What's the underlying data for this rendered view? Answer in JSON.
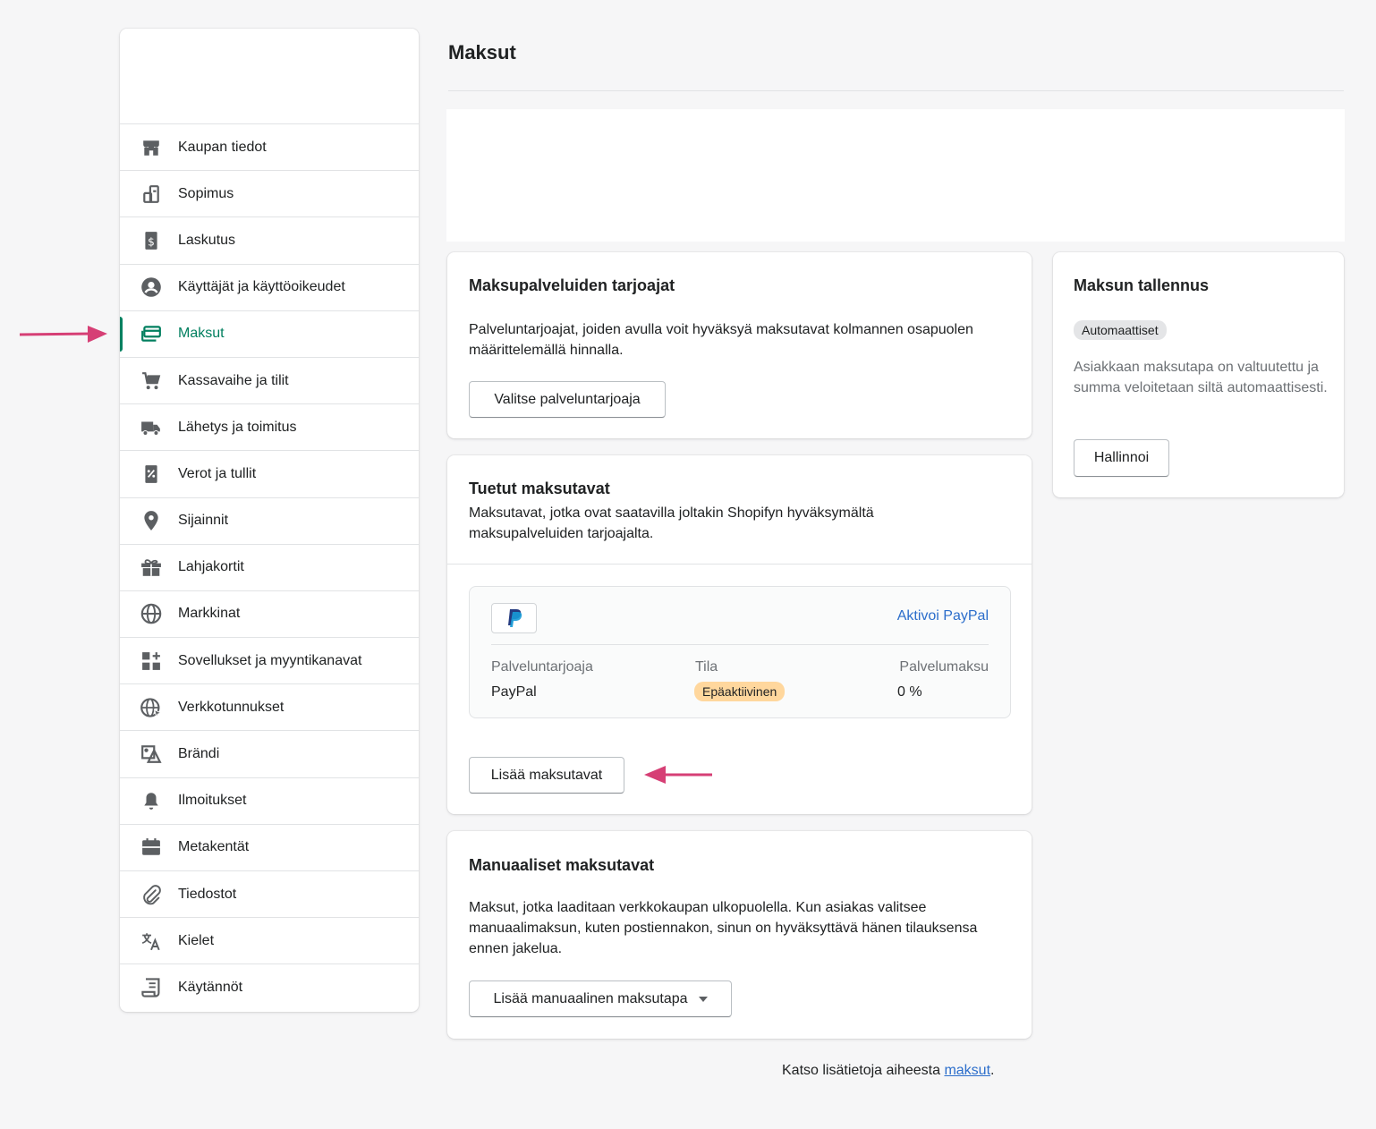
{
  "page": {
    "title": "Maksut"
  },
  "sidebar": {
    "items": [
      {
        "label": "Kaupan tiedot",
        "icon": "store-icon"
      },
      {
        "label": "Sopimus",
        "icon": "plan-icon"
      },
      {
        "label": "Laskutus",
        "icon": "billing-icon"
      },
      {
        "label": "Käyttäjät ja käyttöoikeudet",
        "icon": "user-icon"
      },
      {
        "label": "Maksut",
        "icon": "payments-icon",
        "active": true
      },
      {
        "label": "Kassavaihe ja tilit",
        "icon": "cart-icon"
      },
      {
        "label": "Lähetys ja toimitus",
        "icon": "truck-icon"
      },
      {
        "label": "Verot ja tullit",
        "icon": "tax-icon"
      },
      {
        "label": "Sijainnit",
        "icon": "location-icon"
      },
      {
        "label": "Lahjakortit",
        "icon": "gift-icon"
      },
      {
        "label": "Markkinat",
        "icon": "globe-icon"
      },
      {
        "label": "Sovellukset ja myyntikanavat",
        "icon": "apps-icon"
      },
      {
        "label": "Verkkotunnukset",
        "icon": "domain-icon"
      },
      {
        "label": "Brändi",
        "icon": "brand-icon"
      },
      {
        "label": "Ilmoitukset",
        "icon": "bell-icon"
      },
      {
        "label": "Metakentät",
        "icon": "metafields-icon"
      },
      {
        "label": "Tiedostot",
        "icon": "paperclip-icon"
      },
      {
        "label": "Kielet",
        "icon": "translate-icon"
      },
      {
        "label": "Käytännöt",
        "icon": "policy-icon"
      }
    ]
  },
  "providers": {
    "title": "Maksupalveluiden tarjoajat",
    "description": "Palveluntarjoajat, joiden avulla voit hyväksyä maksutavat kolmannen osapuolen määrittelemällä hinnalla.",
    "button": "Valitse palveluntarjoaja"
  },
  "supported": {
    "title": "Tuetut maksutavat",
    "description": "Maksutavat, jotka ovat saatavilla joltakin Shopifyn hyväksymältä maksupalveluiden tarjoajalta.",
    "activate_link": "Aktivoi PayPal",
    "columns": {
      "provider": "Palveluntarjoaja",
      "status": "Tila",
      "fee": "Palvelumaksu"
    },
    "row": {
      "provider": "PayPal",
      "status": "Epäaktiivinen",
      "fee": "0 %"
    },
    "button": "Lisää maksutavat"
  },
  "manual": {
    "title": "Manuaaliset maksutavat",
    "description": "Maksut, jotka laaditaan verkkokaupan ulkopuolella. Kun asiakas valitsee manuaalimaksun, kuten postiennakon, sinun on hyväksyttävä hänen tilauksensa ennen jakelua.",
    "button": "Lisää manuaalinen maksutapa"
  },
  "capture": {
    "title": "Maksun tallennus",
    "badge": "Automaattiset",
    "description": "Asiakkaan maksutapa on valtuutettu ja summa veloitetaan siltä automaattisesti.",
    "button": "Hallinnoi"
  },
  "footer": {
    "text": "Katso lisätietoja aiheesta ",
    "link": "maksut",
    "suffix": "."
  },
  "colors": {
    "accent": "#008060",
    "annotation_arrow": "#d63f75",
    "link": "#2c6ecb",
    "warning_badge": "#ffd79d"
  }
}
